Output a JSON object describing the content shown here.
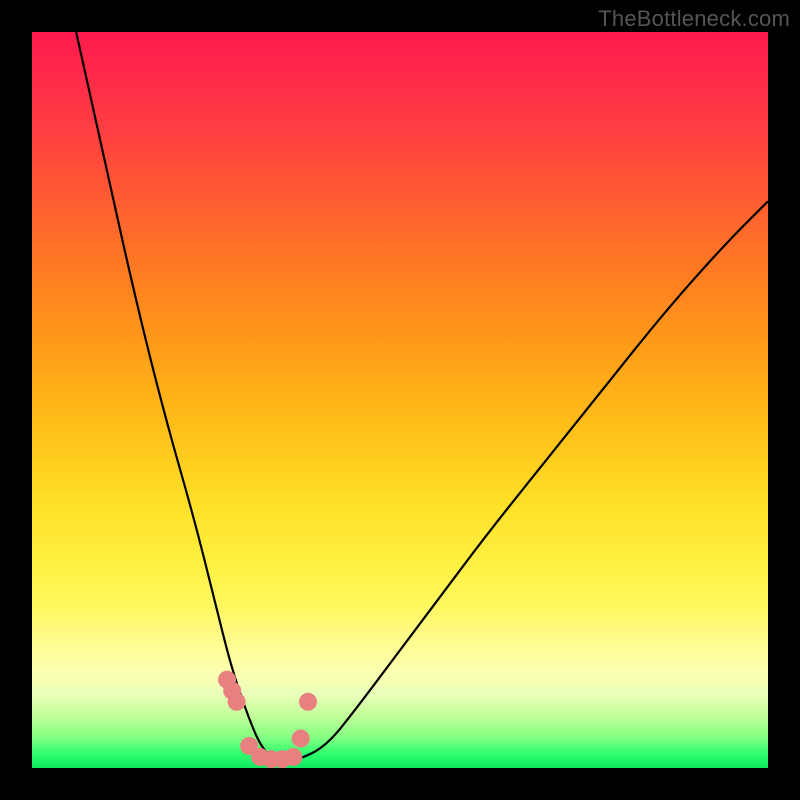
{
  "watermark": "TheBottleneck.com",
  "chart_data": {
    "type": "line",
    "title": "",
    "xlabel": "",
    "ylabel": "",
    "xlim": [
      0,
      100
    ],
    "ylim": [
      0,
      100
    ],
    "grid": false,
    "series": [
      {
        "name": "bottleneck-curve",
        "x": [
          6,
          10,
          14,
          18,
          22,
          25,
          27,
          29,
          31,
          33,
          36,
          40,
          44,
          50,
          56,
          62,
          70,
          78,
          86,
          94,
          100
        ],
        "values": [
          100,
          82,
          64,
          48,
          34,
          22,
          14,
          8,
          3,
          1,
          1,
          3,
          8,
          16,
          24,
          32,
          42,
          52,
          62,
          71,
          77
        ]
      },
      {
        "name": "marker-dots",
        "x": [
          26.5,
          27.2,
          27.8,
          29.5,
          31.0,
          32.5,
          34.0,
          35.5,
          36.5,
          37.5
        ],
        "values": [
          12.0,
          10.5,
          9.0,
          3.0,
          1.5,
          1.2,
          1.2,
          1.5,
          4.0,
          9.0
        ]
      }
    ],
    "colors": {
      "curve": "#000000",
      "dots": "#e88080",
      "gradient_top": "#ff1a4d",
      "gradient_mid": "#fff040",
      "gradient_bottom": "#10e860"
    }
  }
}
